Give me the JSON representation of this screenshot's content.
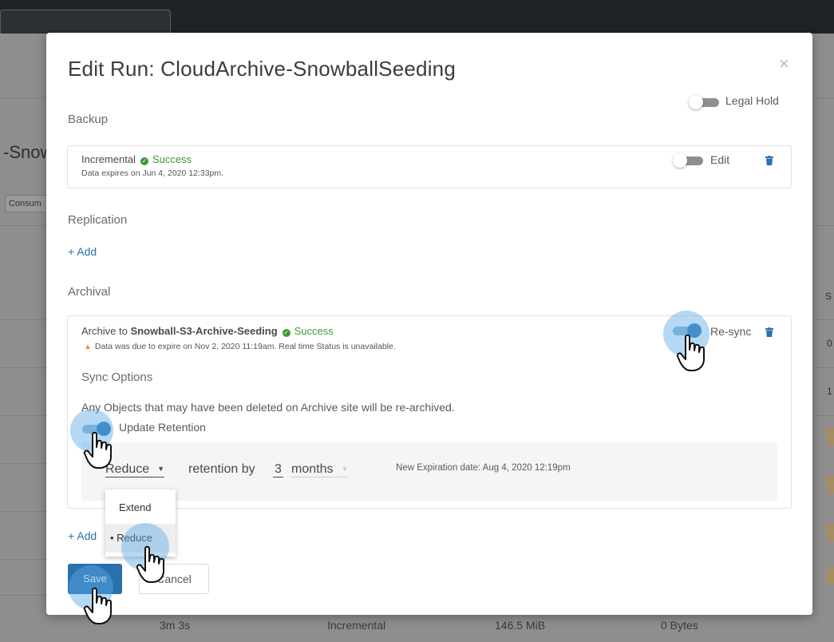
{
  "background": {
    "title_fragment": "-Snow",
    "chip": "Consum",
    "right_s": "S",
    "right_0": "0",
    "right_1": "1",
    "bottom_row": [
      "3m 3s",
      "Incremental",
      "146.5 MiB",
      "0 Bytes"
    ]
  },
  "modal": {
    "title": "Edit Run: CloudArchive-SnowballSeeding",
    "close": "×",
    "legal_hold_label": "Legal Hold",
    "backup": {
      "section_label": "Backup",
      "type": "Incremental",
      "status": "Success",
      "expiry": "Data expires on Jun 4, 2020 12:33pm.",
      "edit_label": "Edit"
    },
    "replication": {
      "section_label": "Replication",
      "add_label": "+ Add"
    },
    "archival": {
      "section_label": "Archival",
      "target_prefix": "Archive to",
      "target_name": "Snowball-S3-Archive-Seeding",
      "status": "Success",
      "warning": "Data was due to expire on Nov 2, 2020 11:19am. Real time Status is unavailable.",
      "resync_label": "Re-sync",
      "sync_options_label": "Sync Options",
      "sync_description": "Any Objects that may have been deleted on Archive site will be re-archived.",
      "update_retention_label": "Update Retention",
      "retention_action": "Reduce",
      "retention_by_label": "retention by",
      "retention_amount": "3",
      "retention_unit": "months",
      "new_expiration": "New Expiration date: Aug 4, 2020 12:19pm",
      "dropdown_options": [
        "Extend",
        "• Reduce"
      ],
      "add_label": "+ Add"
    },
    "save_label": "Save",
    "cancel_label": "Cancel"
  },
  "colors": {
    "primary": "#2b6fae",
    "success": "#3a9a3a",
    "warning": "#e2a02b",
    "toggle_on": "#2f78b7"
  },
  "icons": [
    "close-icon",
    "check-circle-icon",
    "warning-icon",
    "trash-icon",
    "caret-down-icon",
    "pointer-hand-icon"
  ]
}
